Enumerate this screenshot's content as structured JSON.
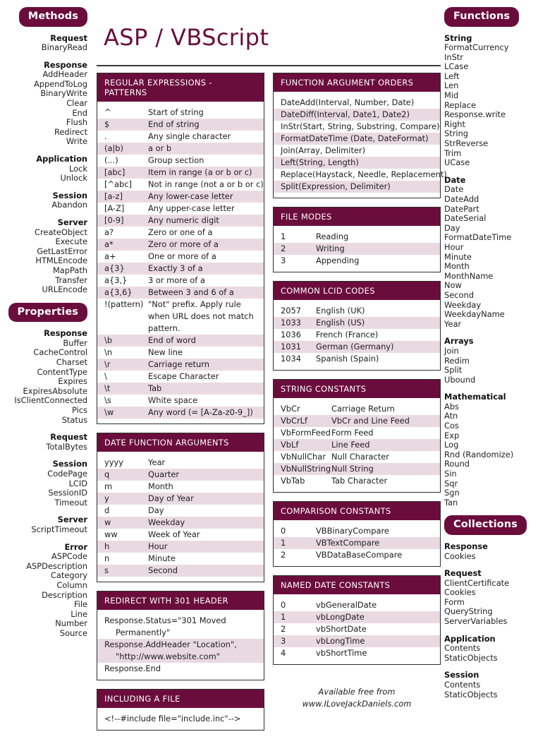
{
  "title": "ASP / VBScript",
  "theme": {
    "accent": "#6b0d3c",
    "row_alt": "#e9dae2",
    "border": "#2e2e2e",
    "text": "#1d1d1d"
  },
  "left_sidebar": {
    "badges": {
      "methods": "Methods",
      "properties": "Properties"
    },
    "methods_groups": [
      {
        "head": "Request",
        "items": [
          "BinaryRead"
        ]
      },
      {
        "head": "Response",
        "items": [
          "AddHeader",
          "AppendToLog",
          "BinaryWrite",
          "Clear",
          "End",
          "Flush",
          "Redirect",
          "Write"
        ]
      },
      {
        "head": "Application",
        "items": [
          "Lock",
          "Unlock"
        ]
      },
      {
        "head": "Session",
        "items": [
          "Abandon"
        ]
      },
      {
        "head": "Server",
        "items": [
          "CreateObject",
          "Execute",
          "GetLastError",
          "HTMLEncode",
          "MapPath",
          "Transfer",
          "URLEncode"
        ]
      }
    ],
    "properties_groups": [
      {
        "head": "Response",
        "items": [
          "Buffer",
          "CacheControl",
          "Charset",
          "ContentType",
          "Expires",
          "ExpiresAbsolute",
          "IsClientConnected",
          "Pics",
          "Status"
        ]
      },
      {
        "head": "Request",
        "items": [
          "TotalBytes"
        ]
      },
      {
        "head": "Session",
        "items": [
          "CodePage",
          "LCID",
          "SessionID",
          "Timeout"
        ]
      },
      {
        "head": "Server",
        "items": [
          "ScriptTimeout"
        ]
      },
      {
        "head": "Error",
        "items": [
          "ASPCode",
          "ASPDescription",
          "Category",
          "Column",
          "Description",
          "File",
          "Line",
          "Number",
          "Source"
        ]
      }
    ]
  },
  "right_sidebar": {
    "badges": {
      "functions": "Functions",
      "collections": "Collections"
    },
    "functions_groups": [
      {
        "head": "String",
        "items": [
          "FormatCurrency",
          "InStr",
          "LCase",
          "Left",
          "Len",
          "Mid",
          "Replace",
          "Response.write",
          "Right",
          "String",
          "StrReverse",
          "Trim",
          "UCase"
        ]
      },
      {
        "head": "Date",
        "items": [
          "Date",
          "DateAdd",
          "DatePart",
          "DateSerial",
          "Day",
          "FormatDateTime",
          "Hour",
          "Minute",
          "Month",
          "MonthName",
          "Now",
          "Second",
          "Weekday",
          "WeekdayName",
          "Year"
        ]
      },
      {
        "head": "Arrays",
        "items": [
          "Join",
          "Redim",
          "Split",
          "Ubound"
        ]
      },
      {
        "head": "Mathematical",
        "items": [
          "Abs",
          "Atn",
          "Cos",
          "Exp",
          "Log",
          "Rnd (Randomize)",
          "Round",
          "Sin",
          "Sqr",
          "Sgn",
          "Tan"
        ]
      }
    ],
    "collections_groups": [
      {
        "head": "Response",
        "items": [
          "Cookies"
        ]
      },
      {
        "head": "Request",
        "items": [
          "ClientCertificate",
          "Cookies",
          "Form",
          "QueryString",
          "ServerVariables"
        ]
      },
      {
        "head": "Application",
        "items": [
          "Contents",
          "StaticObjects"
        ]
      },
      {
        "head": "Session",
        "items": [
          "Contents",
          "StaticObjects"
        ]
      }
    ]
  },
  "panels": {
    "regex": {
      "title": "REGULAR EXPRESSIONS - PATTERNS",
      "rows": [
        [
          "^",
          "Start of string"
        ],
        [
          "$",
          "End of string"
        ],
        [
          ".",
          "Any single character"
        ],
        [
          "(a|b)",
          "a or b"
        ],
        [
          "(...)",
          "Group section"
        ],
        [
          "[abc]",
          "Item in range (a or b or c)"
        ],
        [
          "[^abc]",
          "Not in range (not a or b or c)"
        ],
        [
          "[a-z]",
          "Any lower-case letter"
        ],
        [
          "[A-Z]",
          "Any upper-case letter"
        ],
        [
          "[0-9]",
          "Any numeric digit"
        ],
        [
          "a?",
          "Zero or one of a"
        ],
        [
          "a*",
          "Zero or more of a"
        ],
        [
          "a+",
          "One or more of a"
        ],
        [
          "a{3}",
          "Exactly 3 of a"
        ],
        [
          "a{3,}",
          "3 or more of a"
        ],
        [
          "a{3,6}",
          "Between 3 and 6 of a"
        ],
        [
          "!(pattern)",
          "\"Not\" prefix. Apply rule when URL does not match pattern."
        ],
        [
          "\\b",
          "End of word"
        ],
        [
          "\\n",
          "New line"
        ],
        [
          "\\r",
          "Carriage return"
        ],
        [
          "\\",
          "Escape Character"
        ],
        [
          "\\t",
          "Tab"
        ],
        [
          "\\s",
          "White space"
        ],
        [
          "\\w",
          "Any word (= [A-Za-z0-9_])"
        ]
      ]
    },
    "date_args": {
      "title": "DATE FUNCTION ARGUMENTS",
      "rows": [
        [
          "yyyy",
          "Year"
        ],
        [
          "q",
          "Quarter"
        ],
        [
          "m",
          "Month"
        ],
        [
          "y",
          "Day of Year"
        ],
        [
          "d",
          "Day"
        ],
        [
          "w",
          "Weekday"
        ],
        [
          "ww",
          "Week of Year"
        ],
        [
          "h",
          "Hour"
        ],
        [
          "n",
          "Minute"
        ],
        [
          "s",
          "Second"
        ]
      ]
    },
    "redirect": {
      "title": "REDIRECT WITH 301 HEADER",
      "lines": [
        {
          "text": "Response.Status=\"301 Moved",
          "cont": "Permanently\"",
          "alt": false
        },
        {
          "text": "Response.AddHeader \"Location\",",
          "cont": "\"http://www.website.com\"",
          "alt": true
        },
        {
          "text": "Response.End",
          "cont": "",
          "alt": false
        }
      ]
    },
    "include": {
      "title": "INCLUDING A FILE",
      "lines": [
        {
          "text": "<!--#include file=\"include.inc\"-->",
          "cont": "",
          "alt": false
        }
      ]
    },
    "func_args": {
      "title": "FUNCTION ARGUMENT ORDERS",
      "rows": [
        "DateAdd(Interval, Number, Date)",
        "DateDiff(Interval, Date1, Date2)",
        "InStr(Start, String, Substring, Compare)",
        "FormatDateTime (Date, DateFormat)",
        "Join(Array, Delimiter)",
        "Left(String, Length)",
        "Replace(Haystack, Needle, Replacement)",
        "Split(Expression, Delimiter)"
      ]
    },
    "file_modes": {
      "title": "FILE MODES",
      "rows": [
        [
          "1",
          "Reading"
        ],
        [
          "2",
          "Writing"
        ],
        [
          "3",
          "Appending"
        ]
      ]
    },
    "lcid": {
      "title": "COMMON LCID CODES",
      "rows": [
        [
          "2057",
          "English (UK)"
        ],
        [
          "1033",
          "English (US)"
        ],
        [
          "1036",
          "French (France)"
        ],
        [
          "1031",
          "German (Germany)"
        ],
        [
          "1034",
          "Spanish (Spain)"
        ]
      ]
    },
    "string_constants": {
      "title": "STRING CONSTANTS",
      "rows": [
        [
          "VbCr",
          "Carriage Return"
        ],
        [
          "VbCrLf",
          "VbCr and Line Feed"
        ],
        [
          "VbFormFeed",
          "Form Feed"
        ],
        [
          "VbLf",
          "Line Feed"
        ],
        [
          "VbNullChar",
          "Null Character"
        ],
        [
          "VbNullString",
          "Null String"
        ],
        [
          "VbTab",
          "Tab Character"
        ]
      ]
    },
    "comparison_constants": {
      "title": "COMPARISON CONSTANTS",
      "rows": [
        [
          "0",
          "VBBinaryCompare"
        ],
        [
          "1",
          "VBTextCompare"
        ],
        [
          "2",
          "VBDataBaseCompare"
        ]
      ]
    },
    "named_date_constants": {
      "title": "NAMED DATE CONSTANTS",
      "rows": [
        [
          "0",
          "vbGeneralDate"
        ],
        [
          "1",
          "vbLongDate"
        ],
        [
          "2",
          "vbShortDate"
        ],
        [
          "3",
          "vbLongTime"
        ],
        [
          "4",
          "vbShortTime"
        ]
      ]
    }
  },
  "footer": {
    "line1": "Available free from",
    "line2": "www.ILoveJackDaniels.com"
  }
}
